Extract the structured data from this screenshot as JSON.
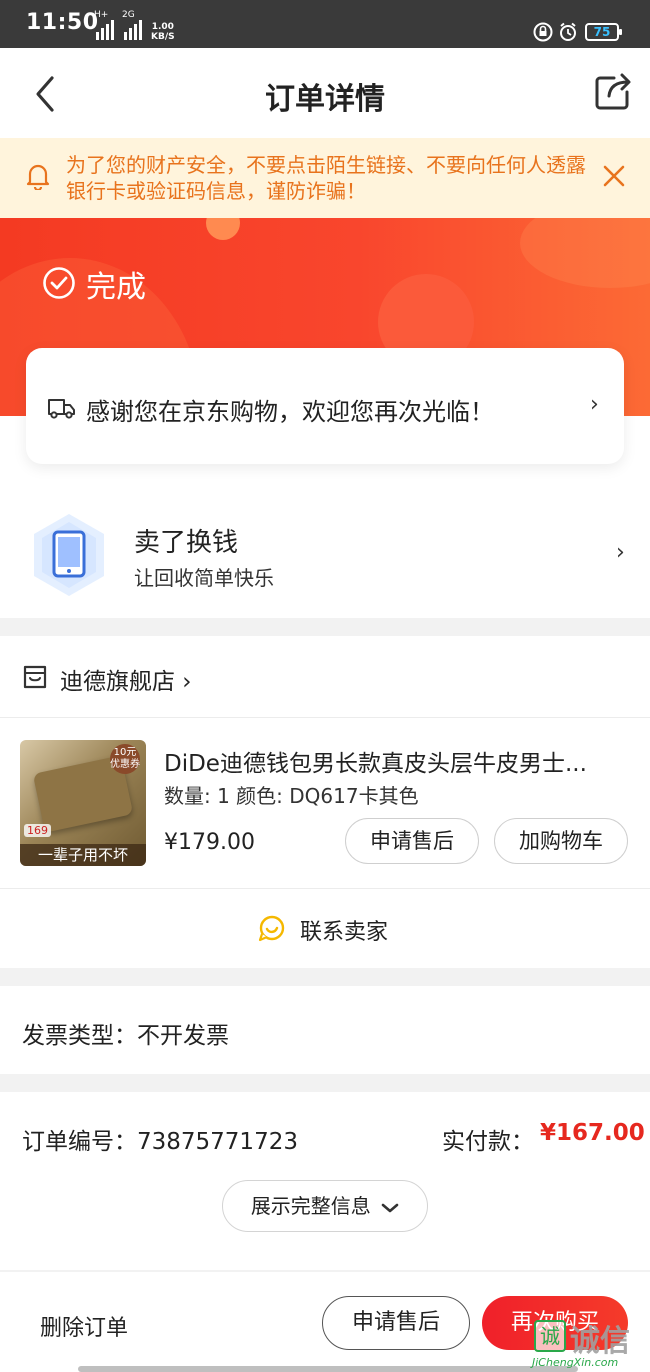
{
  "status_bar": {
    "time": "11:50",
    "network_type_1": "H+",
    "network_type_2": "2G",
    "speed_value": "1.00",
    "speed_unit": "KB/S",
    "battery": "75"
  },
  "nav": {
    "title": "订单详情"
  },
  "notice": {
    "text": "为了您的财产安全，不要点击陌生链接、不要向任何人透露银行卡或验证码信息，谨防诈骗！"
  },
  "order_status": {
    "label": "完成",
    "message": "感谢您在京东购物，欢迎您再次光临！"
  },
  "trade_in": {
    "title": "卖了换钱",
    "subtitle": "让回收简单快乐"
  },
  "store": {
    "name": "迪德旗舰店",
    "product": {
      "title": "DiDe迪德钱包男长款真皮头层牛皮男士...",
      "spec": "数量: 1 颜色: DQ617卡其色",
      "price": "¥179.00",
      "thumb_badge": "10元 优惠券",
      "thumb_price": "169",
      "thumb_slogan": "一辈子用不坏",
      "after_sale_label": "申请售后",
      "add_cart_label": "加购物车"
    },
    "contact_label": "联系卖家"
  },
  "invoice": {
    "text": "发票类型：不开发票"
  },
  "order_info": {
    "number_text": "订单编号：73875771723",
    "paid_label": "实付款：",
    "paid_value": "¥167.00",
    "expand_label": "展示完整信息"
  },
  "bottom_bar": {
    "delete_label": "删除订单",
    "after_sale_label": "申请售后",
    "rebuy_label": "再次购买"
  },
  "watermark": {
    "logo_char": "诚",
    "name": "诚信",
    "domain": "JiChengXin.com"
  },
  "colors": {
    "accent_red": "#e6281f",
    "notice_text": "#e8731d",
    "notice_bg": "#fff4dc",
    "hero_start": "#f43a22",
    "hero_end": "#fc6a35"
  }
}
